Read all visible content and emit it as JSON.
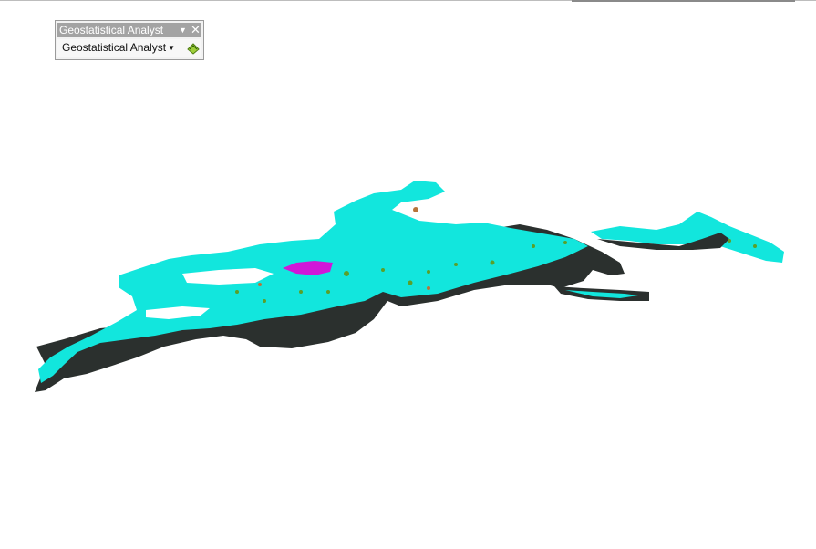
{
  "toolbar": {
    "title": "Geostatistical Analyst",
    "menu_label": "Geostatistical Analyst",
    "title_dropdown_icon": "triangle-down",
    "close_icon": "x",
    "menu_caret_icon": "small-triangle-down",
    "tool_icon": "geostatistical-wizard-icon"
  },
  "colors": {
    "terrain_primary": "#12e6dd",
    "terrain_dark": "#2b302e",
    "highlight": "#d017d8",
    "vegetation": "#5aa02a",
    "soil": "#b8743a"
  }
}
